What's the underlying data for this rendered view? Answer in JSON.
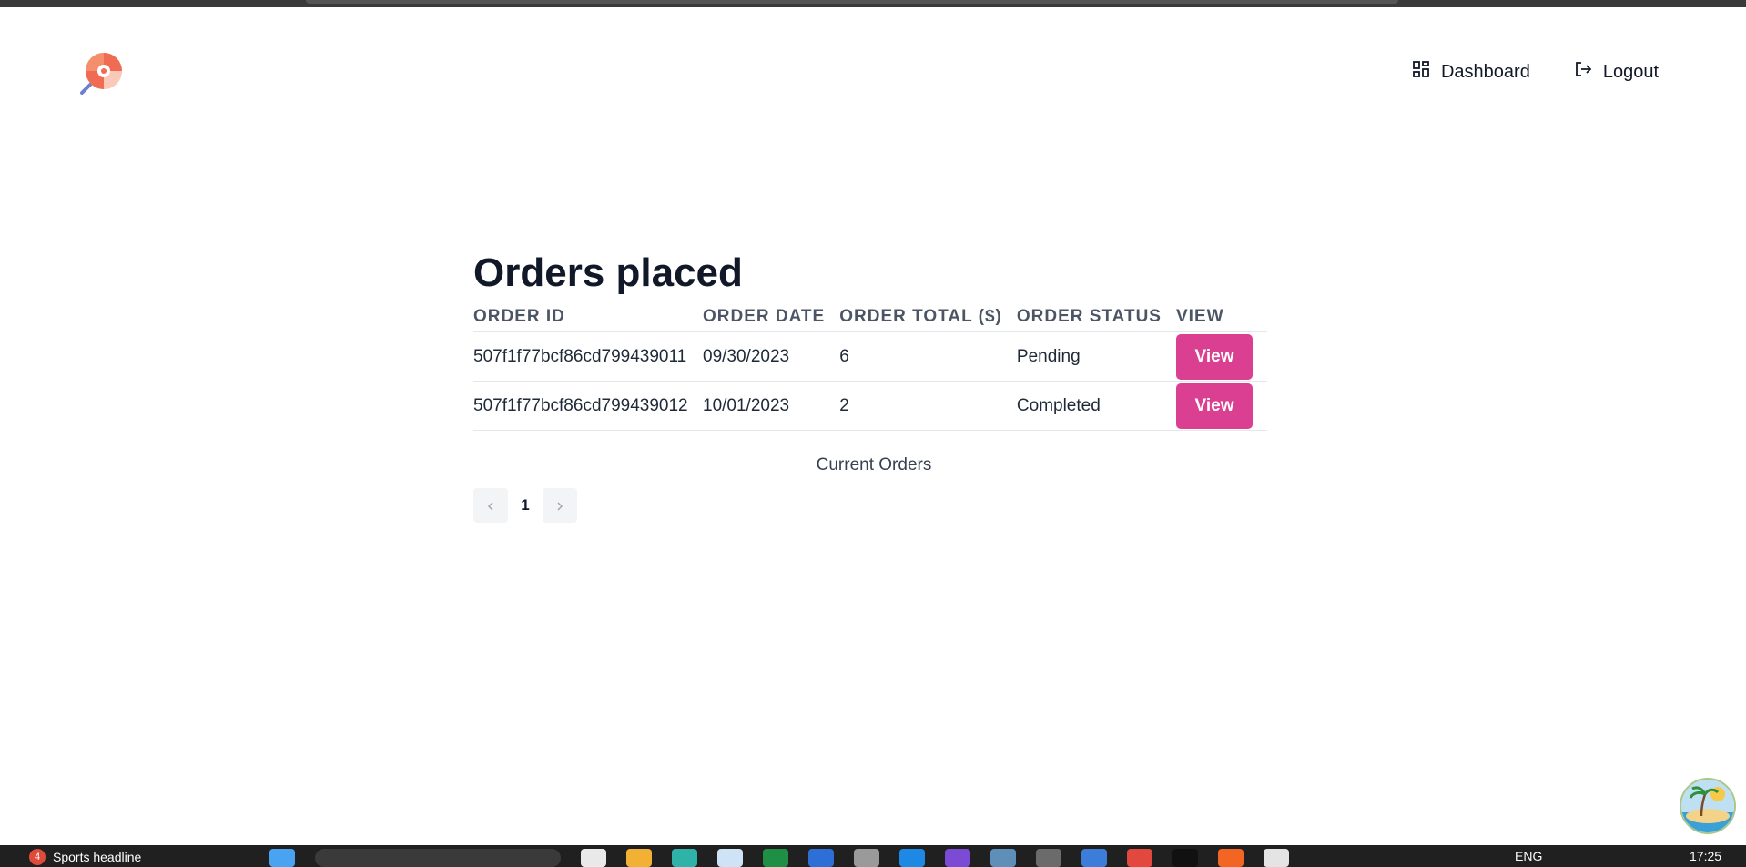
{
  "header": {
    "logo_icon": "lollipop-icon",
    "nav": [
      {
        "label": "Dashboard",
        "icon": "grid-icon"
      },
      {
        "label": "Logout",
        "icon": "logout-icon"
      }
    ]
  },
  "main": {
    "title": "Orders placed",
    "table": {
      "columns": [
        "ORDER ID",
        "ORDER DATE",
        "ORDER TOTAL ($)",
        "ORDER STATUS",
        "VIEW"
      ],
      "rows": [
        {
          "order_id": "507f1f77bcf86cd799439011",
          "order_date": "09/30/2023",
          "order_total": "6",
          "status": "Pending",
          "action": "View"
        },
        {
          "order_id": "507f1f77bcf86cd799439012",
          "order_date": "10/01/2023",
          "order_total": "2",
          "status": "Completed",
          "action": "View"
        }
      ],
      "caption": "Current Orders"
    },
    "pagination": {
      "prev_icon": "chevron-left-icon",
      "current_page": "1",
      "next_icon": "chevron-right-icon"
    }
  },
  "colors": {
    "accent": "#db3f92",
    "text": "#111827",
    "header_text": "#4b5563"
  },
  "taskbar": {
    "news_badge": "4",
    "news_text": "Sports headline",
    "language": "ENG",
    "time": "17:25"
  }
}
